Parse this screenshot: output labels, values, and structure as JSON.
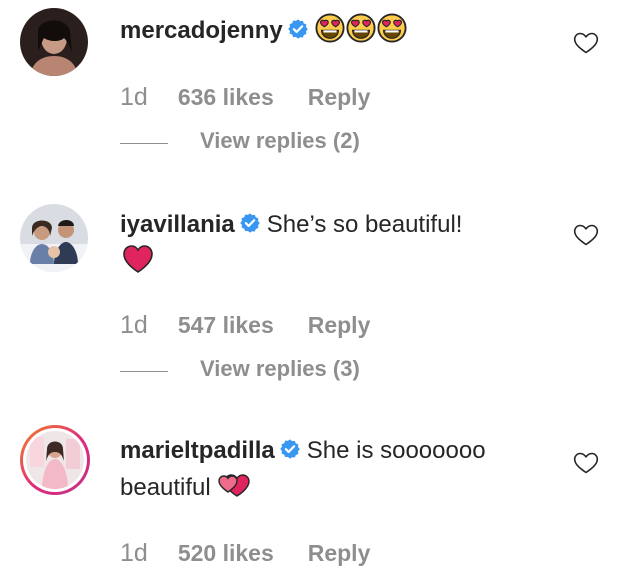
{
  "comments": [
    {
      "username": "mercadojenny",
      "text": "",
      "emojis": [
        "heart-eyes-emoji",
        "heart-eyes-emoji",
        "heart-eyes-emoji"
      ],
      "time": "1d",
      "likes": "636 likes",
      "reply": "Reply",
      "view_replies": "View replies (2)"
    },
    {
      "username": "iyavillania",
      "text": "She’s so beautiful!",
      "emojis": [
        "red-heart-emoji"
      ],
      "time": "1d",
      "likes": "547 likes",
      "reply": "Reply",
      "view_replies": "View replies (3)"
    },
    {
      "username": "marieltpadilla",
      "text": "She is sooooooo",
      "text2": "beautiful",
      "emojis": [
        "two-hearts-emoji"
      ],
      "time": "1d",
      "likes": "520 likes",
      "reply": "Reply"
    }
  ],
  "colors": {
    "text": "#262626",
    "muted": "#8e8e8e",
    "verified": "#3897f0",
    "heart": "#e0245e",
    "story_ring_start": "#f58529",
    "story_ring_end": "#c13584"
  }
}
